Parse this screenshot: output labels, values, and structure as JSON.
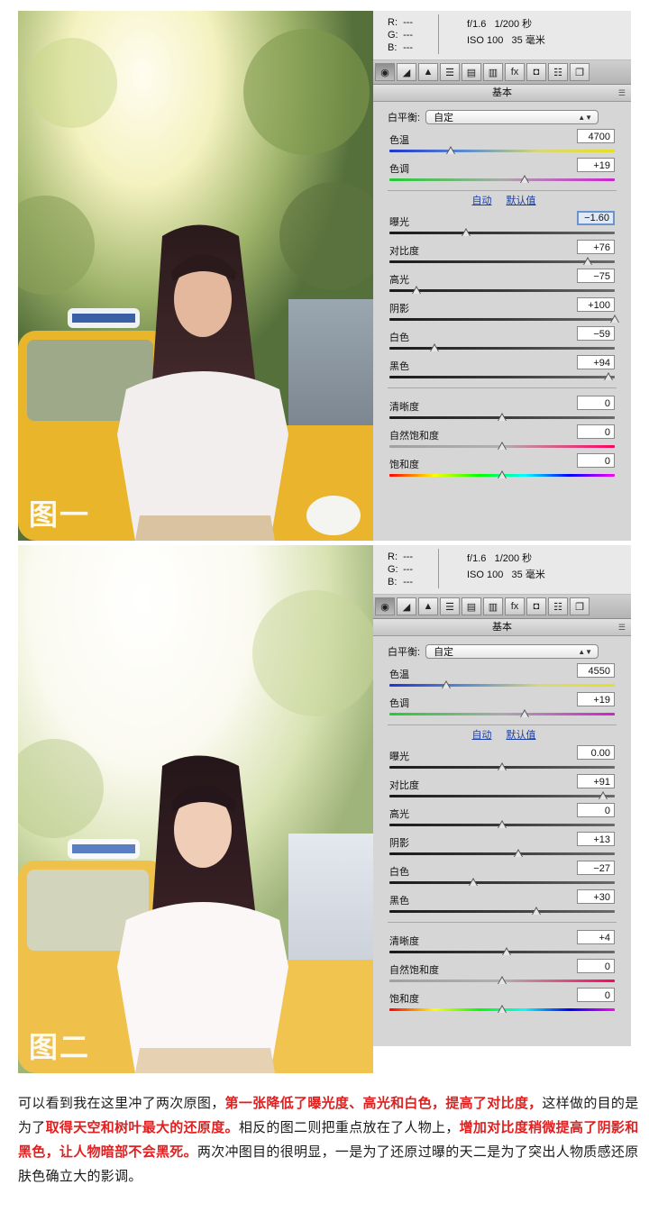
{
  "figures": [
    {
      "figure_label": "图一",
      "panel": {
        "rgb": {
          "r_label": "R:",
          "g_label": "G:",
          "b_label": "B:",
          "r": "---",
          "g": "---",
          "b": "---"
        },
        "camera": {
          "aperture_shutter": "f/1.6   1/200 秒",
          "iso_focal": "ISO 100   35 毫米"
        },
        "tools": [
          "◉",
          "◢",
          "▲",
          "☰",
          "▤",
          "▥",
          "fx",
          "◘",
          "☷",
          "❐"
        ],
        "tab_title": "基本",
        "white_balance_label": "白平衡:",
        "white_balance_value": "自定",
        "temp_label": "色温",
        "temp_value": "4700",
        "temp_pos": 0.27,
        "tint_label": "色调",
        "tint_value": "+19",
        "tint_pos": 0.6,
        "auto_link": "自动",
        "default_link": "默认值",
        "tone": [
          {
            "label": "曝光",
            "value": "−1.60",
            "pos": 0.34,
            "focus": true
          },
          {
            "label": "对比度",
            "value": "+76",
            "pos": 0.88
          },
          {
            "label": "高光",
            "value": "−75",
            "pos": 0.12
          },
          {
            "label": "阴影",
            "value": "+100",
            "pos": 1.0
          },
          {
            "label": "白色",
            "value": "−59",
            "pos": 0.2
          },
          {
            "label": "黑色",
            "value": "+94",
            "pos": 0.97
          }
        ],
        "presence": [
          {
            "label": "清晰度",
            "value": "0",
            "pos": 0.5,
            "track": "gray"
          },
          {
            "label": "自然饱和度",
            "value": "0",
            "pos": 0.5,
            "track": "vib"
          },
          {
            "label": "饱和度",
            "value": "0",
            "pos": 0.5,
            "track": "sat"
          }
        ]
      }
    },
    {
      "figure_label": "图二",
      "panel": {
        "rgb": {
          "r_label": "R:",
          "g_label": "G:",
          "b_label": "B:",
          "r": "---",
          "g": "---",
          "b": "---"
        },
        "camera": {
          "aperture_shutter": "f/1.6   1/200 秒",
          "iso_focal": "ISO 100   35 毫米"
        },
        "tools": [
          "◉",
          "◢",
          "▲",
          "☰",
          "▤",
          "▥",
          "fx",
          "◘",
          "☷",
          "❐"
        ],
        "tab_title": "基本",
        "white_balance_label": "白平衡:",
        "white_balance_value": "自定",
        "temp_label": "色温",
        "temp_value": "4550",
        "temp_pos": 0.25,
        "tint_label": "色调",
        "tint_value": "+19",
        "tint_pos": 0.6,
        "auto_link": "自动",
        "default_link": "默认值",
        "tone": [
          {
            "label": "曝光",
            "value": "0.00",
            "pos": 0.5
          },
          {
            "label": "对比度",
            "value": "+91",
            "pos": 0.95
          },
          {
            "label": "高光",
            "value": "0",
            "pos": 0.5
          },
          {
            "label": "阴影",
            "value": "+13",
            "pos": 0.57
          },
          {
            "label": "白色",
            "value": "−27",
            "pos": 0.37
          },
          {
            "label": "黑色",
            "value": "+30",
            "pos": 0.65
          }
        ],
        "presence": [
          {
            "label": "清晰度",
            "value": "+4",
            "pos": 0.52,
            "track": "gray"
          },
          {
            "label": "自然饱和度",
            "value": "0",
            "pos": 0.5,
            "track": "vib"
          },
          {
            "label": "饱和度",
            "value": "0",
            "pos": 0.5,
            "track": "sat"
          }
        ]
      }
    }
  ],
  "caption": {
    "p1": "可以看到我在这里冲了两次原图，",
    "h1": "第一张降低了曝光度、高光和白色，提高了对比度，",
    "p2": "这样做的目的是为了",
    "h2": "取得天空和树叶最大的还原度。",
    "p3": "相反的图二则把重点放在了人物上，",
    "h3": "增加对比度稍微提高了阴影和黑色，让人物暗部不会黑死。",
    "p4": "两次冲图目的很明显，一是为了还原过曝的天二是为了突出人物质感还原肤色确立大的影调。"
  }
}
